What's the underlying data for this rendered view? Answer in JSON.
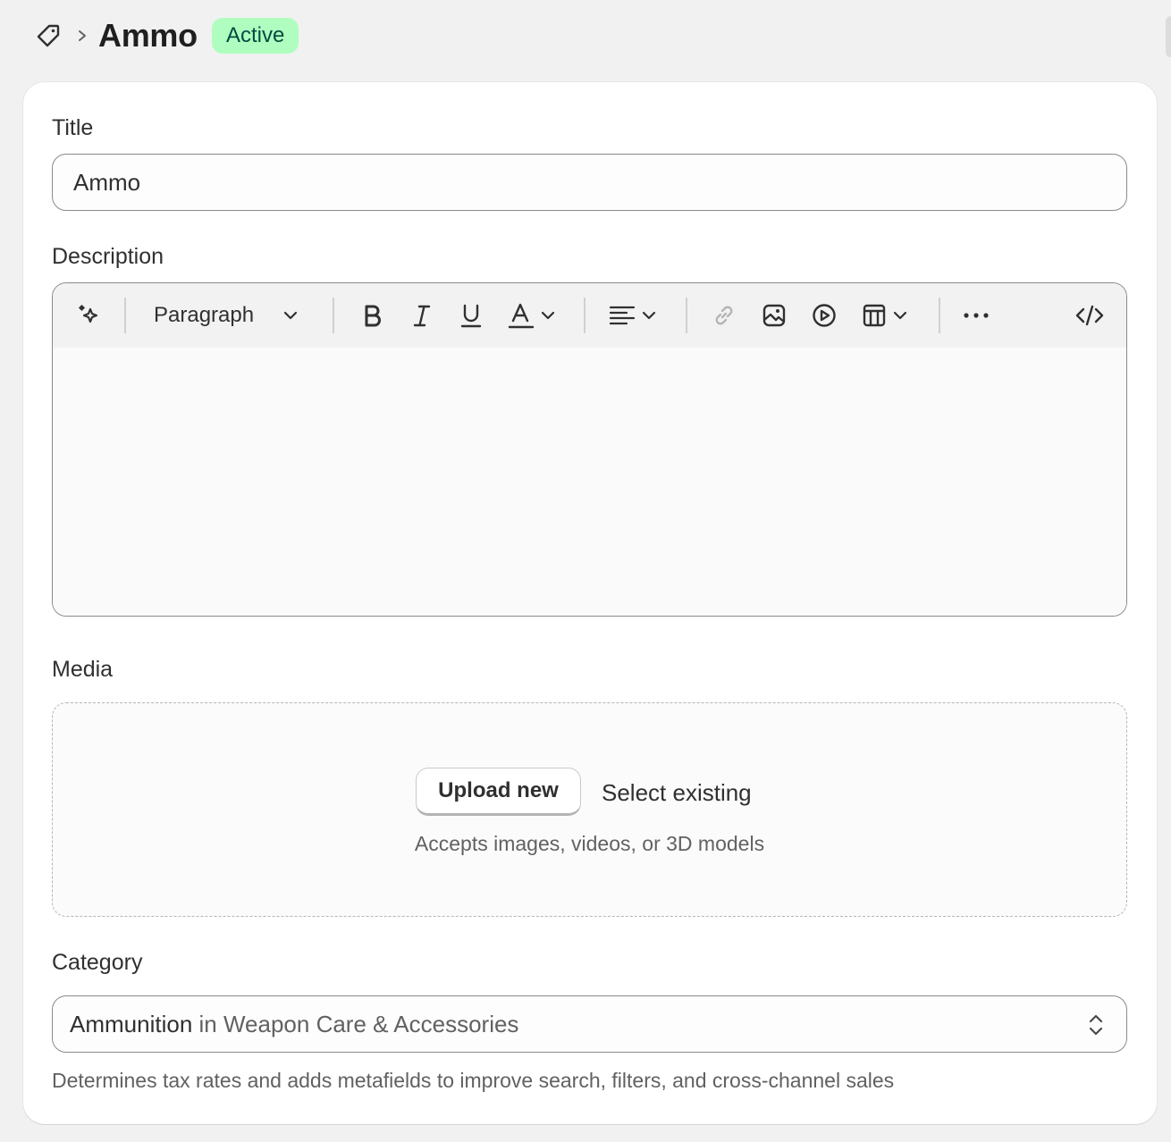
{
  "header": {
    "breadcrumb_icon": "tag-icon",
    "separator_icon": "chevron-right-icon",
    "title": "Ammo",
    "status": "Active"
  },
  "form": {
    "title_label": "Title",
    "title_value": "Ammo",
    "description_label": "Description",
    "toolbar": {
      "ai_icon": "sparkle-icon",
      "paragraph_style": "Paragraph",
      "icons": [
        "bold-icon",
        "italic-icon",
        "underline-icon",
        "text-color-icon",
        "align-icon",
        "link-icon",
        "image-icon",
        "video-icon",
        "table-icon",
        "more-icon",
        "code-icon"
      ]
    },
    "media_label": "Media",
    "upload_label": "Upload new",
    "select_existing_label": "Select existing",
    "media_hint": "Accepts images, videos, or 3D models",
    "category_label": "Category",
    "category_value": "Ammunition",
    "category_connector": " in ",
    "category_parent": "Weapon Care & Accessories",
    "category_help": "Determines tax rates and adds metafields to improve search, filters, and cross-channel sales"
  },
  "colors": {
    "page_bg": "#f1f1f1",
    "badge_bg": "#affebf",
    "badge_text": "#014b40"
  }
}
